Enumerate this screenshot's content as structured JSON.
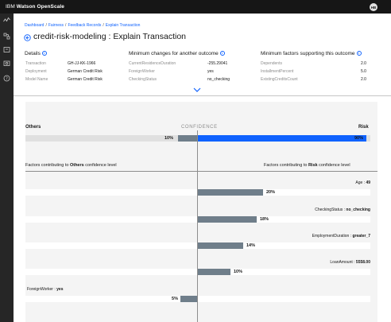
{
  "app": {
    "brand_prefix": "IBM",
    "brand_name": "Watson OpenScale",
    "avatar_initials": "HB"
  },
  "sidebar": {
    "icons": [
      "activity-icon",
      "model-icon",
      "chart-icon",
      "calculator-icon",
      "help-icon"
    ]
  },
  "breadcrumb": [
    "Dashboard",
    "Fairness",
    "Feedback Records",
    "Explain Transaction"
  ],
  "page_title": "credit-risk-modeling : Explain Transaction",
  "details": {
    "heading": "Details",
    "rows": [
      {
        "key": "Transaction",
        "value": "GH-JJ-KK-1966"
      },
      {
        "key": "Deployment",
        "value": "German Credit Risk"
      },
      {
        "key": "Model Name",
        "value": "German Credit Risk"
      }
    ]
  },
  "min_changes": {
    "heading": "Minimum changes for another outcome",
    "rows": [
      {
        "key": "CurrentResidenceDuration",
        "value": "-255.29041"
      },
      {
        "key": "ForeignWorker",
        "value": "yes"
      },
      {
        "key": "CheckingStatus",
        "value": "no_checking"
      }
    ]
  },
  "min_factors": {
    "heading": "Minimum factors supporting this outcome",
    "rows": [
      {
        "key": "Dependents",
        "value": "2.0"
      },
      {
        "key": "InstallmentPercent",
        "value": "5.0"
      },
      {
        "key": "ExistingCreditsCount",
        "value": "2.0"
      }
    ]
  },
  "confidence": {
    "label": "CONFIDENCE",
    "others_label": "Others",
    "risk_label": "Risk",
    "others_pct": 10,
    "risk_pct": 90,
    "others_text": "10%",
    "risk_text": "90%"
  },
  "factor_heads": {
    "left_prefix": "Factors contributing to ",
    "left_bold": "Others",
    "left_suffix": " confidence level",
    "right_prefix": "Factors contributing to ",
    "right_bold": "Risk",
    "right_suffix": " confidence level"
  },
  "factors": [
    {
      "name": "Age",
      "value": "49",
      "side": "risk",
      "pct": 20,
      "text": "20%"
    },
    {
      "name": "CheckingStatus",
      "value": "no_checking",
      "side": "risk",
      "pct": 18,
      "text": "18%"
    },
    {
      "name": "EmploymentDuration",
      "value": "greater_7",
      "side": "risk",
      "pct": 14,
      "text": "14%"
    },
    {
      "name": "LoanAmount",
      "value": "5558.00",
      "side": "risk",
      "pct": 10,
      "text": "10%"
    },
    {
      "name": "ForeignWorker",
      "value": "yes",
      "side": "others",
      "pct": 5,
      "text": "5%"
    }
  ],
  "colors": {
    "accent": "#0f62fe",
    "bar_gray": "#6f7e8a",
    "topbar": "#161616",
    "sidebar": "#262626"
  }
}
